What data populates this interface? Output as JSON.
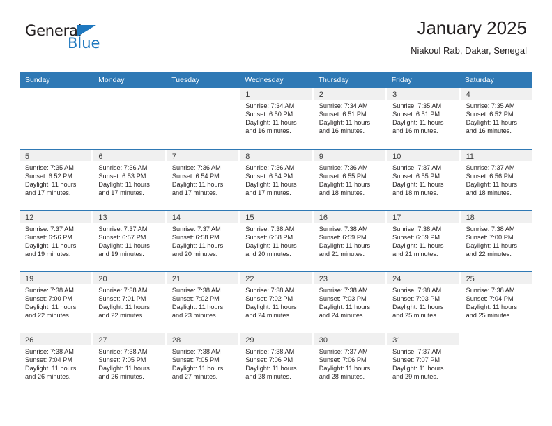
{
  "logo": {
    "word_top": "General",
    "word_bottom": "Blue",
    "triangle_icon": "blue-triangle-icon",
    "brand_blue": "#1f78bf"
  },
  "header": {
    "title": "January 2025",
    "subtitle": "Niakoul Rab, Dakar, Senegal"
  },
  "colors": {
    "header_blue": "#2f79b5",
    "day_bar_gray": "#f0f0f0",
    "text": "#231f20"
  },
  "weekdays": [
    "Sunday",
    "Monday",
    "Tuesday",
    "Wednesday",
    "Thursday",
    "Friday",
    "Saturday"
  ],
  "weeks": [
    [
      {
        "day": "",
        "blank": true,
        "sunrise": "",
        "sunset": "",
        "daylight_line1": "",
        "daylight_line2": ""
      },
      {
        "day": "",
        "blank": true,
        "sunrise": "",
        "sunset": "",
        "daylight_line1": "",
        "daylight_line2": ""
      },
      {
        "day": "",
        "blank": true,
        "sunrise": "",
        "sunset": "",
        "daylight_line1": "",
        "daylight_line2": ""
      },
      {
        "day": "1",
        "sunrise": "Sunrise: 7:34 AM",
        "sunset": "Sunset: 6:50 PM",
        "daylight_line1": "Daylight: 11 hours",
        "daylight_line2": "and 16 minutes."
      },
      {
        "day": "2",
        "sunrise": "Sunrise: 7:34 AM",
        "sunset": "Sunset: 6:51 PM",
        "daylight_line1": "Daylight: 11 hours",
        "daylight_line2": "and 16 minutes."
      },
      {
        "day": "3",
        "sunrise": "Sunrise: 7:35 AM",
        "sunset": "Sunset: 6:51 PM",
        "daylight_line1": "Daylight: 11 hours",
        "daylight_line2": "and 16 minutes."
      },
      {
        "day": "4",
        "sunrise": "Sunrise: 7:35 AM",
        "sunset": "Sunset: 6:52 PM",
        "daylight_line1": "Daylight: 11 hours",
        "daylight_line2": "and 16 minutes."
      }
    ],
    [
      {
        "day": "5",
        "sunrise": "Sunrise: 7:35 AM",
        "sunset": "Sunset: 6:52 PM",
        "daylight_line1": "Daylight: 11 hours",
        "daylight_line2": "and 17 minutes."
      },
      {
        "day": "6",
        "sunrise": "Sunrise: 7:36 AM",
        "sunset": "Sunset: 6:53 PM",
        "daylight_line1": "Daylight: 11 hours",
        "daylight_line2": "and 17 minutes."
      },
      {
        "day": "7",
        "sunrise": "Sunrise: 7:36 AM",
        "sunset": "Sunset: 6:54 PM",
        "daylight_line1": "Daylight: 11 hours",
        "daylight_line2": "and 17 minutes."
      },
      {
        "day": "8",
        "sunrise": "Sunrise: 7:36 AM",
        "sunset": "Sunset: 6:54 PM",
        "daylight_line1": "Daylight: 11 hours",
        "daylight_line2": "and 17 minutes."
      },
      {
        "day": "9",
        "sunrise": "Sunrise: 7:36 AM",
        "sunset": "Sunset: 6:55 PM",
        "daylight_line1": "Daylight: 11 hours",
        "daylight_line2": "and 18 minutes."
      },
      {
        "day": "10",
        "sunrise": "Sunrise: 7:37 AM",
        "sunset": "Sunset: 6:55 PM",
        "daylight_line1": "Daylight: 11 hours",
        "daylight_line2": "and 18 minutes."
      },
      {
        "day": "11",
        "sunrise": "Sunrise: 7:37 AM",
        "sunset": "Sunset: 6:56 PM",
        "daylight_line1": "Daylight: 11 hours",
        "daylight_line2": "and 18 minutes."
      }
    ],
    [
      {
        "day": "12",
        "sunrise": "Sunrise: 7:37 AM",
        "sunset": "Sunset: 6:56 PM",
        "daylight_line1": "Daylight: 11 hours",
        "daylight_line2": "and 19 minutes."
      },
      {
        "day": "13",
        "sunrise": "Sunrise: 7:37 AM",
        "sunset": "Sunset: 6:57 PM",
        "daylight_line1": "Daylight: 11 hours",
        "daylight_line2": "and 19 minutes."
      },
      {
        "day": "14",
        "sunrise": "Sunrise: 7:37 AM",
        "sunset": "Sunset: 6:58 PM",
        "daylight_line1": "Daylight: 11 hours",
        "daylight_line2": "and 20 minutes."
      },
      {
        "day": "15",
        "sunrise": "Sunrise: 7:38 AM",
        "sunset": "Sunset: 6:58 PM",
        "daylight_line1": "Daylight: 11 hours",
        "daylight_line2": "and 20 minutes."
      },
      {
        "day": "16",
        "sunrise": "Sunrise: 7:38 AM",
        "sunset": "Sunset: 6:59 PM",
        "daylight_line1": "Daylight: 11 hours",
        "daylight_line2": "and 21 minutes."
      },
      {
        "day": "17",
        "sunrise": "Sunrise: 7:38 AM",
        "sunset": "Sunset: 6:59 PM",
        "daylight_line1": "Daylight: 11 hours",
        "daylight_line2": "and 21 minutes."
      },
      {
        "day": "18",
        "sunrise": "Sunrise: 7:38 AM",
        "sunset": "Sunset: 7:00 PM",
        "daylight_line1": "Daylight: 11 hours",
        "daylight_line2": "and 22 minutes."
      }
    ],
    [
      {
        "day": "19",
        "sunrise": "Sunrise: 7:38 AM",
        "sunset": "Sunset: 7:00 PM",
        "daylight_line1": "Daylight: 11 hours",
        "daylight_line2": "and 22 minutes."
      },
      {
        "day": "20",
        "sunrise": "Sunrise: 7:38 AM",
        "sunset": "Sunset: 7:01 PM",
        "daylight_line1": "Daylight: 11 hours",
        "daylight_line2": "and 22 minutes."
      },
      {
        "day": "21",
        "sunrise": "Sunrise: 7:38 AM",
        "sunset": "Sunset: 7:02 PM",
        "daylight_line1": "Daylight: 11 hours",
        "daylight_line2": "and 23 minutes."
      },
      {
        "day": "22",
        "sunrise": "Sunrise: 7:38 AM",
        "sunset": "Sunset: 7:02 PM",
        "daylight_line1": "Daylight: 11 hours",
        "daylight_line2": "and 24 minutes."
      },
      {
        "day": "23",
        "sunrise": "Sunrise: 7:38 AM",
        "sunset": "Sunset: 7:03 PM",
        "daylight_line1": "Daylight: 11 hours",
        "daylight_line2": "and 24 minutes."
      },
      {
        "day": "24",
        "sunrise": "Sunrise: 7:38 AM",
        "sunset": "Sunset: 7:03 PM",
        "daylight_line1": "Daylight: 11 hours",
        "daylight_line2": "and 25 minutes."
      },
      {
        "day": "25",
        "sunrise": "Sunrise: 7:38 AM",
        "sunset": "Sunset: 7:04 PM",
        "daylight_line1": "Daylight: 11 hours",
        "daylight_line2": "and 25 minutes."
      }
    ],
    [
      {
        "day": "26",
        "sunrise": "Sunrise: 7:38 AM",
        "sunset": "Sunset: 7:04 PM",
        "daylight_line1": "Daylight: 11 hours",
        "daylight_line2": "and 26 minutes."
      },
      {
        "day": "27",
        "sunrise": "Sunrise: 7:38 AM",
        "sunset": "Sunset: 7:05 PM",
        "daylight_line1": "Daylight: 11 hours",
        "daylight_line2": "and 26 minutes."
      },
      {
        "day": "28",
        "sunrise": "Sunrise: 7:38 AM",
        "sunset": "Sunset: 7:05 PM",
        "daylight_line1": "Daylight: 11 hours",
        "daylight_line2": "and 27 minutes."
      },
      {
        "day": "29",
        "sunrise": "Sunrise: 7:38 AM",
        "sunset": "Sunset: 7:06 PM",
        "daylight_line1": "Daylight: 11 hours",
        "daylight_line2": "and 28 minutes."
      },
      {
        "day": "30",
        "sunrise": "Sunrise: 7:37 AM",
        "sunset": "Sunset: 7:06 PM",
        "daylight_line1": "Daylight: 11 hours",
        "daylight_line2": "and 28 minutes."
      },
      {
        "day": "31",
        "sunrise": "Sunrise: 7:37 AM",
        "sunset": "Sunset: 7:07 PM",
        "daylight_line1": "Daylight: 11 hours",
        "daylight_line2": "and 29 minutes."
      },
      {
        "day": "",
        "blank": true,
        "sunrise": "",
        "sunset": "",
        "daylight_line1": "",
        "daylight_line2": ""
      }
    ]
  ]
}
